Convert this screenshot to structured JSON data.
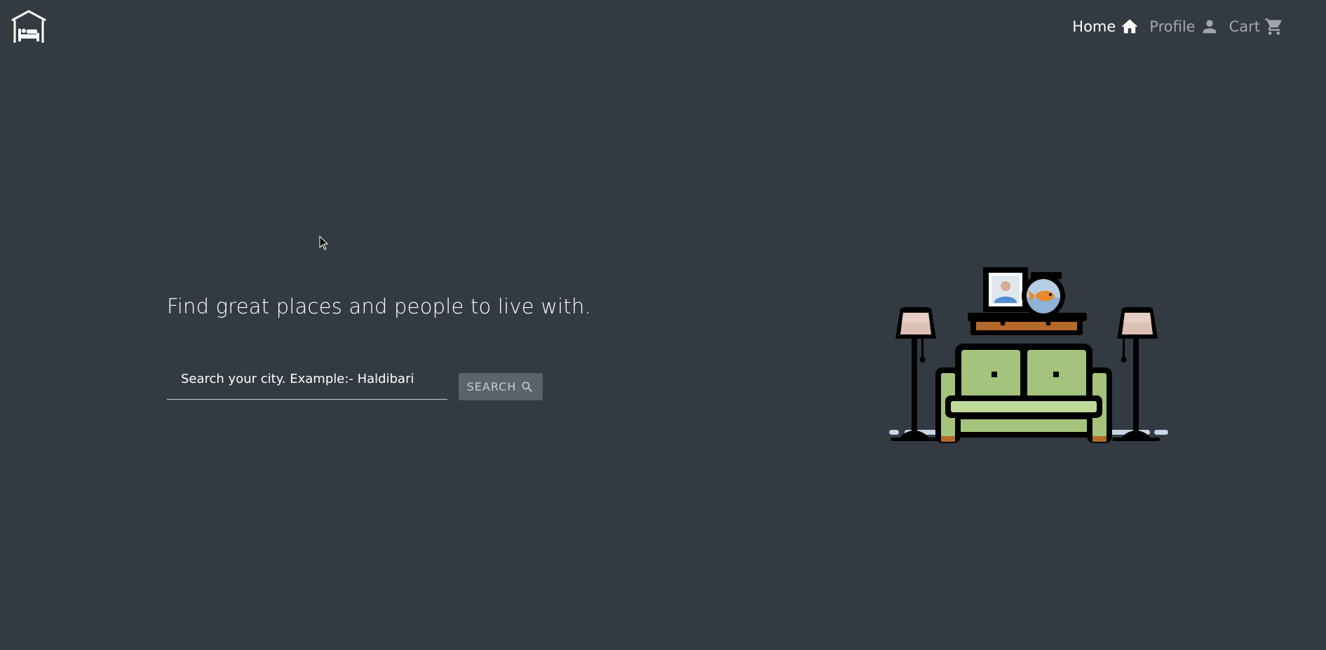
{
  "nav": {
    "brand_icon": "house-bed-icon",
    "links": [
      {
        "label": "Home",
        "icon": "home-icon",
        "active": true
      },
      {
        "label": "Profile",
        "icon": "person-icon",
        "active": false
      },
      {
        "label": "Cart",
        "icon": "cart-icon",
        "active": false
      }
    ]
  },
  "hero": {
    "title": "Find great places and people to live with.",
    "search_placeholder": "Search your city. Example:- Haldibari",
    "search_value": "",
    "search_button_label": "SEARCH",
    "search_button_icon": "search-icon"
  },
  "colors": {
    "background": "#343a41",
    "button": "#5c636a",
    "sofa": "#a4c47d",
    "wood": "#b5692a"
  }
}
